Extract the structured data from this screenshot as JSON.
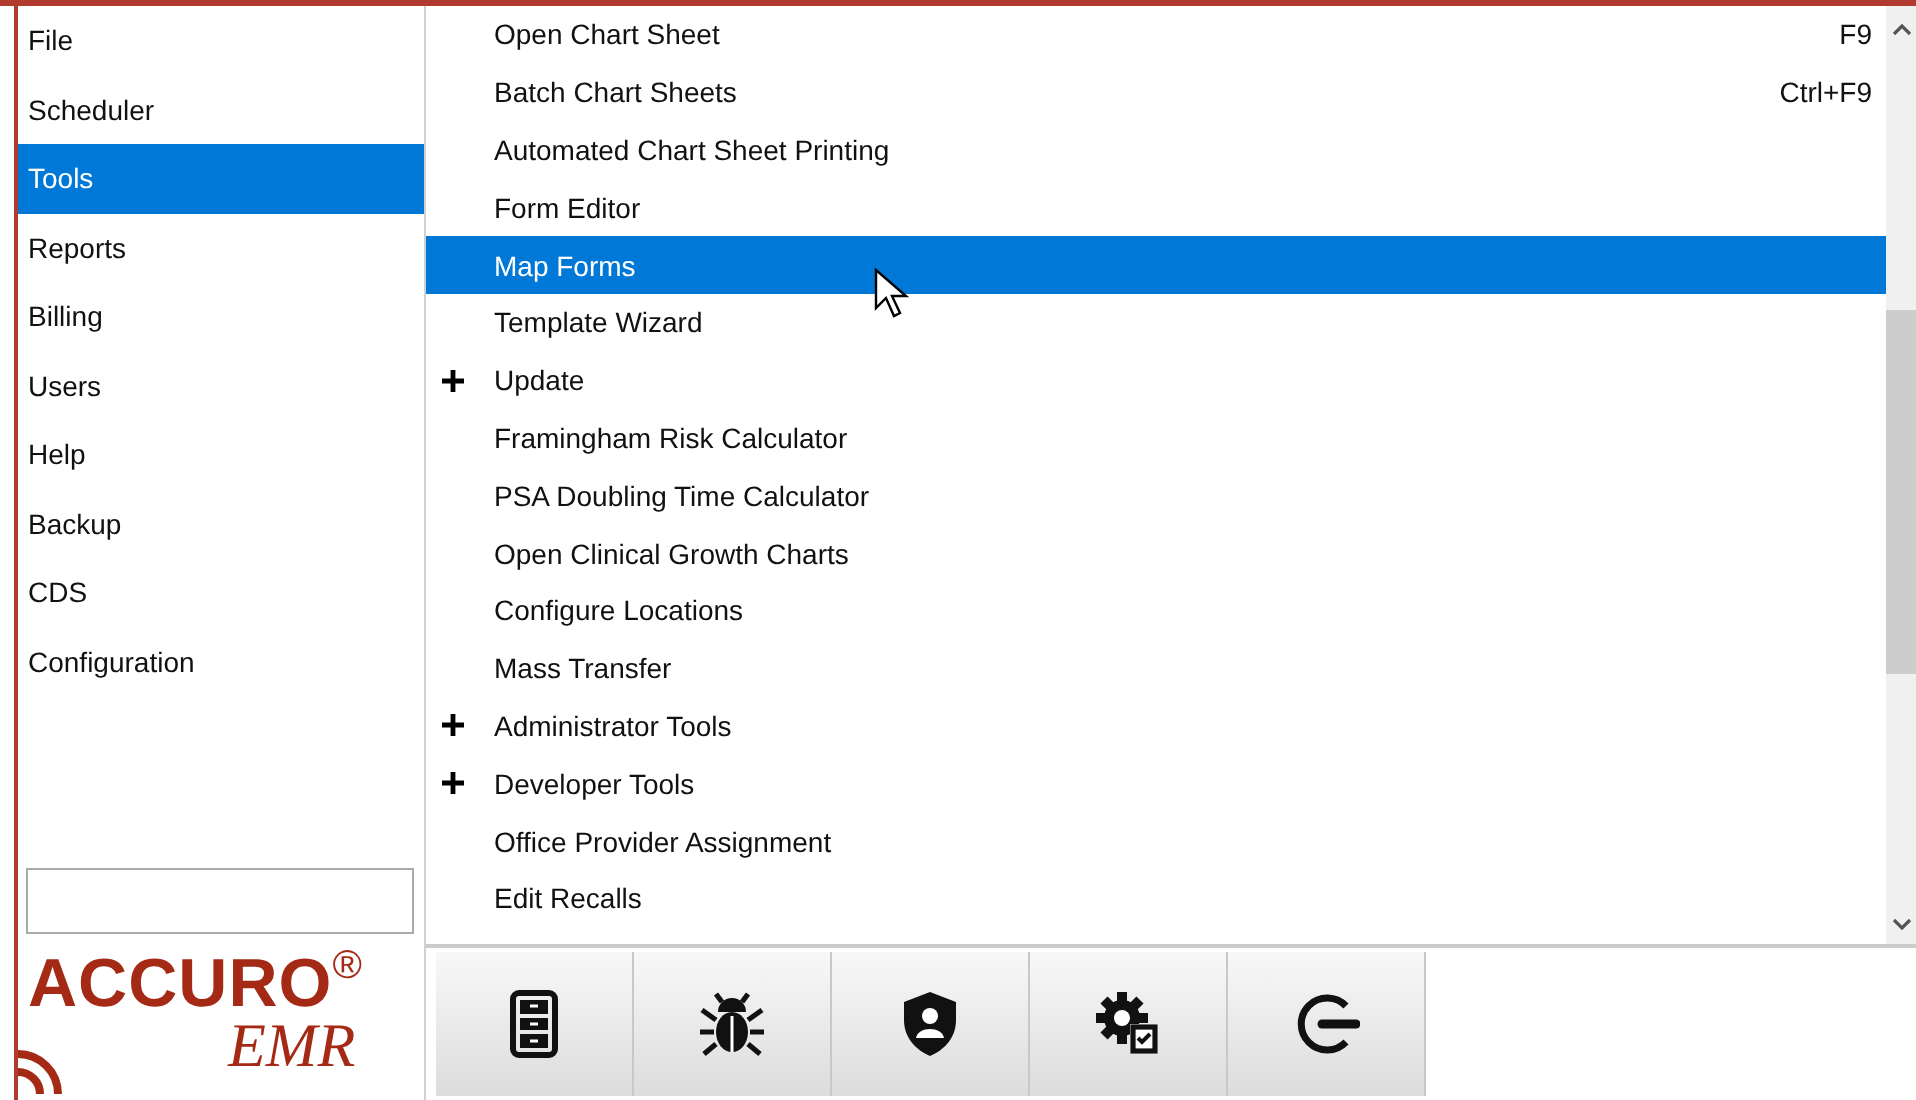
{
  "sidebar": {
    "items": [
      {
        "label": "File",
        "selected": false
      },
      {
        "label": "Scheduler",
        "selected": false
      },
      {
        "label": "Tools",
        "selected": true
      },
      {
        "label": "Reports",
        "selected": false
      },
      {
        "label": "Billing",
        "selected": false
      },
      {
        "label": "Users",
        "selected": false
      },
      {
        "label": "Help",
        "selected": false
      },
      {
        "label": "Backup",
        "selected": false
      },
      {
        "label": "CDS",
        "selected": false
      },
      {
        "label": "Configuration",
        "selected": false
      }
    ]
  },
  "logo": {
    "name": "ACCURO$^{®}$",
    "subtitle": "EMR"
  },
  "menu": {
    "items": [
      {
        "label": "Open Chart Sheet",
        "shortcut": "F9",
        "expandable": false,
        "selected": false
      },
      {
        "label": "Batch Chart Sheets",
        "shortcut": "Ctrl+F9",
        "expandable": false,
        "selected": false
      },
      {
        "label": "Automated Chart Sheet Printing",
        "expandable": false,
        "selected": false
      },
      {
        "label": "Form Editor",
        "expandable": false,
        "selected": false
      },
      {
        "label": "Map Forms",
        "expandable": false,
        "selected": true
      },
      {
        "label": "Template Wizard",
        "expandable": false,
        "selected": false
      },
      {
        "label": "Update",
        "expandable": true,
        "selected": false
      },
      {
        "label": "Framingham Risk Calculator",
        "expandable": false,
        "selected": false
      },
      {
        "label": "PSA Doubling Time Calculator",
        "expandable": false,
        "selected": false
      },
      {
        "label": "Open Clinical Growth Charts",
        "expandable": false,
        "selected": false
      },
      {
        "label": "Configure Locations",
        "expandable": false,
        "selected": false
      },
      {
        "label": "Mass Transfer",
        "expandable": false,
        "selected": false
      },
      {
        "label": "Administrator Tools",
        "expandable": true,
        "selected": false
      },
      {
        "label": "Developer Tools",
        "expandable": true,
        "selected": false
      },
      {
        "label": "Office Provider Assignment",
        "expandable": false,
        "selected": false
      },
      {
        "label": "Edit Recalls",
        "expandable": false,
        "selected": false
      }
    ]
  }
}
